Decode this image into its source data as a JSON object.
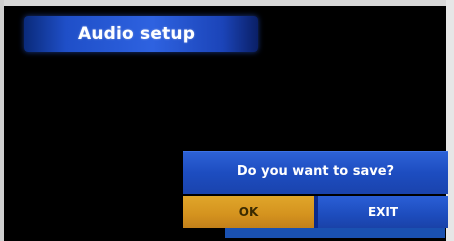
{
  "header": {
    "title": "Audio setup"
  },
  "dialog": {
    "message": "Do you want to save?",
    "ok_label": "OK",
    "exit_label": "EXIT",
    "selected": "OK"
  },
  "colors": {
    "accent_blue": "#1f4fc8",
    "selected_orange": "#d4921e",
    "background": "#000000"
  }
}
